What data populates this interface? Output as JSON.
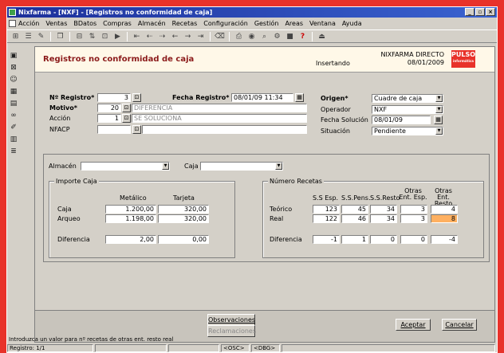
{
  "window": {
    "title": "Nixfarma - [NXF] - [Registros no conformidad de caja]"
  },
  "menu": [
    "Acción",
    "Ventas",
    "BDatos",
    "Compras",
    "Almacén",
    "Recetas",
    "Configuración",
    "Gestión",
    "Areas",
    "Ventana",
    "Ayuda"
  ],
  "header": {
    "title": "Registros no conformidad de caja",
    "brand": "NIXFARMA DIRECTO",
    "date": "08/01/2009",
    "mode": "Insertando",
    "logo": "PULSO",
    "logo_sub": "informática"
  },
  "fields": {
    "registro_label": "Nº Registro*",
    "registro_value": "3",
    "motivo_label": "Motivo*",
    "motivo_code": "20",
    "motivo_text": "DIFERENCIA",
    "accion_label": "Acción",
    "accion_code": "1",
    "accion_text": "SE SOLUCIONA",
    "nfacp_label": "NFACP",
    "nfacp_value": "",
    "fecha_registro_label": "Fecha Registro*",
    "fecha_registro_value": "08/01/09   11:34",
    "origen_label": "Origen*",
    "origen_value": "Cuadre de caja",
    "operador_label": "Operador",
    "operador_value": "NXF",
    "fecha_solucion_label": "Fecha Solución",
    "fecha_solucion_value": "08/01/09",
    "situacion_label": "Situación",
    "situacion_value": "Pendiente",
    "almacen_label": "Almacén",
    "almacen_value": "",
    "caja_label": "Caja",
    "caja_value": ""
  },
  "importe": {
    "title": "Importe Caja",
    "col1": "Metálico",
    "col2": "Tarjeta",
    "rows": [
      {
        "label": "Caja",
        "metalico": "1.200,00",
        "tarjeta": "320,00"
      },
      {
        "label": "Arqueo",
        "metalico": "1.198,00",
        "tarjeta": "320,00"
      }
    ],
    "diff_label": "Diferencia",
    "diff_metalico": "2,00",
    "diff_tarjeta": "0,00"
  },
  "recetas": {
    "title": "Número Recetas",
    "headers": [
      "S.S Esp.",
      "S.S.Pens.",
      "S.S.Resto",
      "Otras Ent. Esp.",
      "Otras Ent. Resto"
    ],
    "rows": [
      {
        "label": "Teórico",
        "values": [
          "123",
          "45",
          "34",
          "3",
          "4"
        ]
      },
      {
        "label": "Real",
        "values": [
          "122",
          "46",
          "34",
          "3",
          "8"
        ]
      }
    ],
    "diff_label": "Diferencia",
    "diff_values": [
      "-1",
      "1",
      "0",
      "0",
      "-4"
    ]
  },
  "buttons": {
    "observaciones": "Observaciones",
    "reclamaciones": "Reclamaciones",
    "aceptar": "Aceptar",
    "cancelar": "Cancelar"
  },
  "status": {
    "hint": "Introduzca un valor para nº recetas de otras ent. resto real",
    "registro": "Registro: 1/1",
    "osc": "<OSC>",
    "dbg": "<DBG>"
  }
}
